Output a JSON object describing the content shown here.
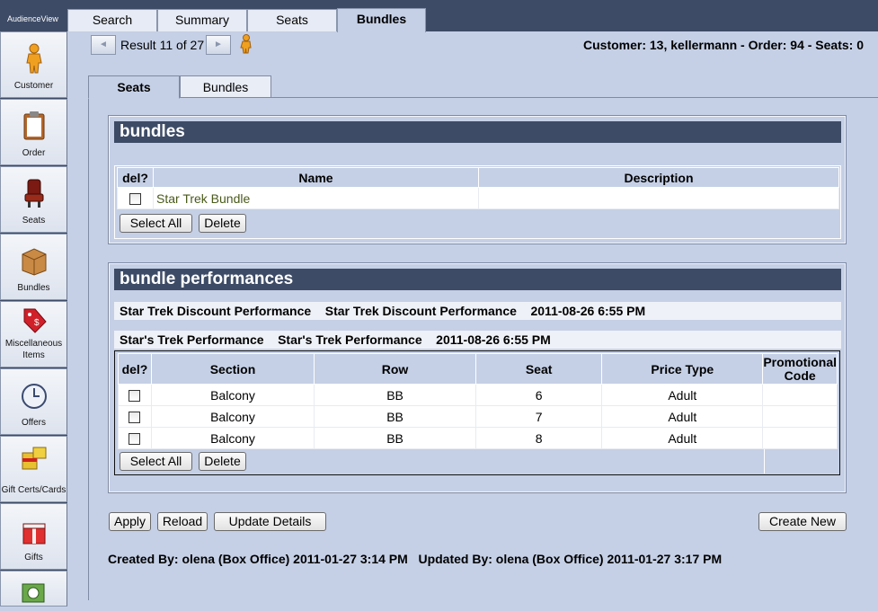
{
  "app": {
    "logo": "AudienceView"
  },
  "main_tabs": [
    {
      "label": "Search"
    },
    {
      "label": "Summary"
    },
    {
      "label": "Seats"
    },
    {
      "label": "Bundles"
    }
  ],
  "sidebar": {
    "items": [
      {
        "label": "Customer",
        "icon": "person-icon"
      },
      {
        "label": "Order",
        "icon": "clipboard-icon"
      },
      {
        "label": "Seats",
        "icon": "seat-icon"
      },
      {
        "label": "Bundles",
        "icon": "box-icon"
      },
      {
        "label": "Miscellaneous Items",
        "icon": "price-tag-icon"
      },
      {
        "label": "Offers",
        "icon": "clock-icon"
      },
      {
        "label": "Gift Certs/Cards",
        "icon": "gift-card-icon"
      },
      {
        "label": "Gifts",
        "icon": "gift-icon"
      }
    ]
  },
  "result_nav": {
    "prev": "◄",
    "next": "►",
    "text": "Result 11 of 27"
  },
  "header_info": "Customer: 13, kellermann - Order: 94 - Seats: 0",
  "sub_tabs": [
    {
      "label": "Seats"
    },
    {
      "label": "Bundles"
    }
  ],
  "bundles": {
    "title": "bundles",
    "columns": {
      "del": "del?",
      "name": "Name",
      "description": "Description"
    },
    "rows": [
      {
        "name": "Star Trek Bundle",
        "description": ""
      }
    ],
    "select_all": "Select All",
    "delete": "Delete"
  },
  "bundle_performances": {
    "title": "bundle performances",
    "performances": [
      "Star Trek Discount Performance    Star Trek Discount Performance    2011-08-26 6:55 PM",
      "Star's Trek Performance    Star's Trek Performance    2011-08-26 6:55 PM"
    ],
    "columns": {
      "del": "del?",
      "section": "Section",
      "row": "Row",
      "seat": "Seat",
      "price_type": "Price Type",
      "promo_1": "Promotional",
      "promo_2": "Code"
    },
    "rows": [
      {
        "section": "Balcony",
        "row": "BB",
        "seat": "6",
        "price_type": "Adult",
        "promo": ""
      },
      {
        "section": "Balcony",
        "row": "BB",
        "seat": "7",
        "price_type": "Adult",
        "promo": ""
      },
      {
        "section": "Balcony",
        "row": "BB",
        "seat": "8",
        "price_type": "Adult",
        "promo": ""
      }
    ],
    "select_all": "Select All",
    "delete": "Delete"
  },
  "actions": {
    "apply": "Apply",
    "reload": "Reload",
    "update_details": "Update Details",
    "create_new": "Create New"
  },
  "footer": "Created By: olena (Box Office) 2011-01-27 3:14 PM   Updated By: olena (Box Office) 2011-01-27 3:17 PM",
  "colors": {
    "header_bar": "#3d4b66",
    "panel_bg": "#c5d0e6",
    "link_green": "#4a5a1a"
  }
}
